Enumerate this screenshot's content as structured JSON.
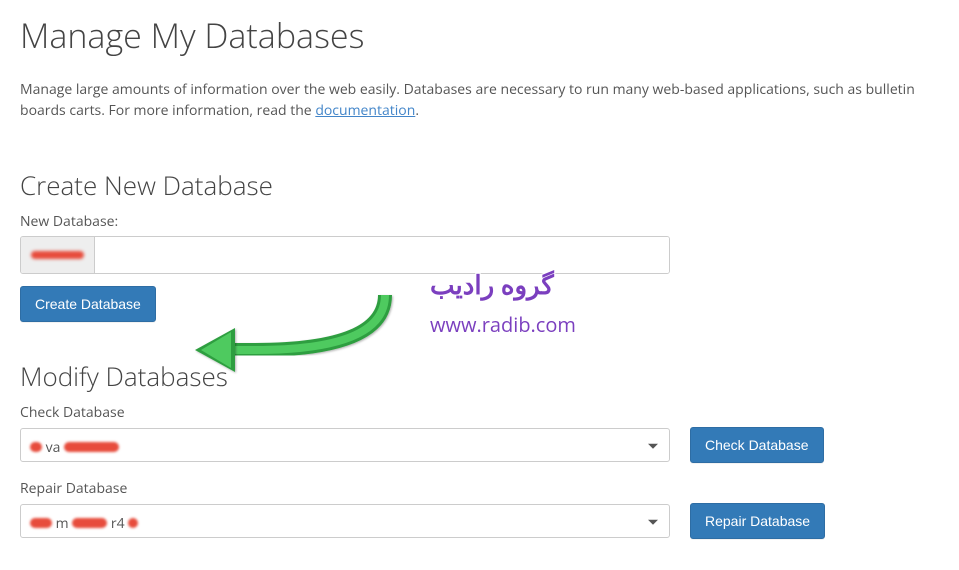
{
  "page": {
    "title": "Manage My Databases",
    "description_part1": "Manage large amounts of information over the web easily. Databases are necessary to run many web-based applications, such as bulletin boards carts. For more information, read the ",
    "description_link": "documentation",
    "description_part2": "."
  },
  "create": {
    "heading": "Create New Database",
    "label": "New Database:",
    "prefix_redacted": "xxxxxxx_",
    "value": "",
    "button": "Create Database"
  },
  "modify": {
    "heading": "Modify Databases",
    "check_label": "Check Database",
    "check_selected": "xxxx_xxxxx",
    "check_button": "Check Database",
    "repair_label": "Repair Database",
    "repair_selected": "xxxxxxx_xxxx",
    "repair_button": "Repair Database"
  },
  "watermark": {
    "persian": "گروه رادیب",
    "url": "www.radib.com"
  }
}
